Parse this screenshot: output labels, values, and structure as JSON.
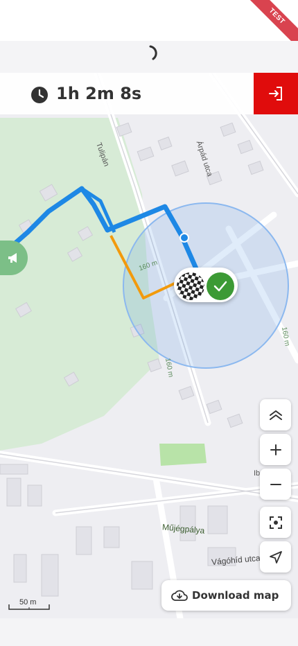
{
  "ribbon": {
    "label": "TEST"
  },
  "timer": {
    "elapsed": "1h 2m 8s"
  },
  "map": {
    "labels": {
      "street_top_left": "Tulipán",
      "street_top": "Árpád utca",
      "street_right": "Ib",
      "street_bottom": "Vágóhíd utca",
      "place": "Műjégpálya",
      "contour_1": "160 m",
      "contour_2": "160 m",
      "contour_3": "160 m"
    },
    "scale_label": "50 m",
    "colors": {
      "track": "#1e88e5",
      "route": "#f29a0c",
      "geofence": "#2f7fe0",
      "green": "#3c9a35",
      "exit": "#e00c0c"
    }
  },
  "controls": {
    "collapse": "chevrons-up-icon",
    "zoom_in": "plus-icon",
    "zoom_out": "minus-icon",
    "center": "focus-icon",
    "navigate": "navigation-arrow-icon"
  },
  "download": {
    "label": "Download map"
  }
}
